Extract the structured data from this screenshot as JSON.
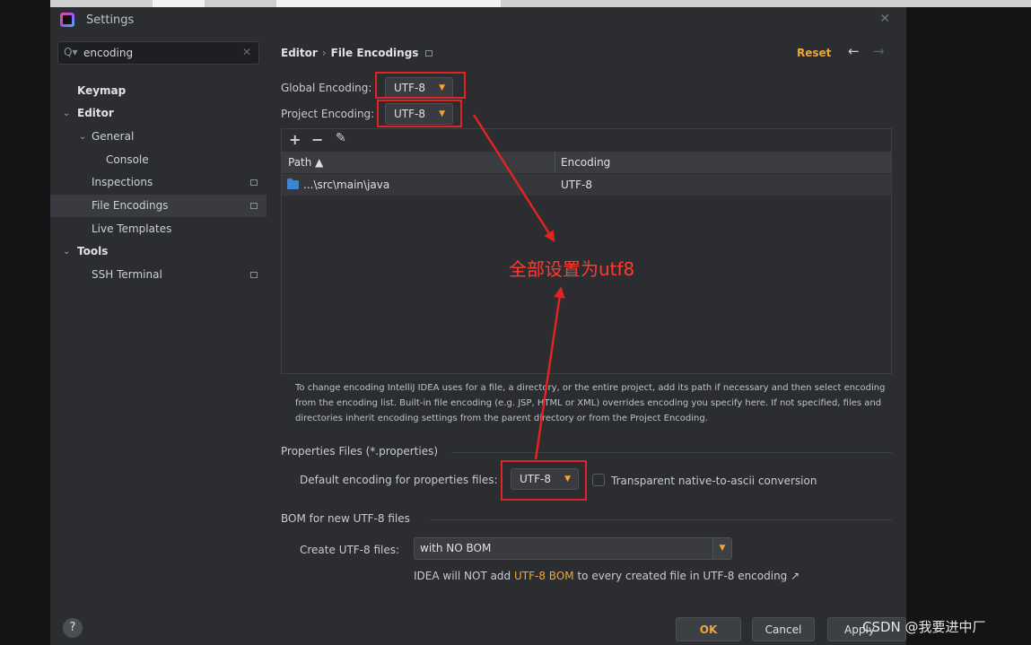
{
  "window": {
    "title": "Settings"
  },
  "search": {
    "value": "encoding"
  },
  "sidebar": {
    "items": [
      {
        "label": "Keymap"
      },
      {
        "label": "Editor"
      },
      {
        "label": "General"
      },
      {
        "label": "Console"
      },
      {
        "label": "Inspections"
      },
      {
        "label": "File Encodings"
      },
      {
        "label": "Live Templates"
      },
      {
        "label": "Tools"
      },
      {
        "label": "SSH Terminal"
      }
    ]
  },
  "header": {
    "breadcrumb_parent": "Editor",
    "breadcrumb_sep": "›",
    "breadcrumb_current": "File Encodings",
    "reset_label": "Reset"
  },
  "global_encoding": {
    "label": "Global Encoding:",
    "value": "UTF-8"
  },
  "project_encoding": {
    "label": "Project Encoding:",
    "value": "UTF-8"
  },
  "table": {
    "toolbar": {
      "add": "+",
      "remove": "−",
      "edit": "✎"
    },
    "columns": {
      "path": "Path ▲",
      "encoding": "Encoding"
    },
    "rows": [
      {
        "path": "...\\src\\main\\java",
        "encoding": "UTF-8"
      }
    ]
  },
  "description": "To change encoding IntelliJ IDEA uses for a file, a directory, or the entire project, add its path if necessary and then select encoding from the encoding list. Built-in file encoding (e.g. JSP, HTML or XML) overrides encoding you specify here. If not specified, files and directories inherit encoding settings from the parent directory or from the Project Encoding.",
  "properties": {
    "section_title": "Properties Files (*.properties)",
    "default_label": "Default encoding for properties files:",
    "default_value": "UTF-8",
    "transparent_label": "Transparent native-to-ascii conversion"
  },
  "bom": {
    "section_title": "BOM for new UTF-8 files",
    "create_label": "Create UTF-8 files:",
    "create_value": "with NO BOM",
    "note_prefix": "IDEA will NOT add",
    "note_highlight": "UTF-8 BOM",
    "note_suffix": "to every created file in UTF-8 encoding ↗"
  },
  "footer": {
    "help": "?",
    "ok": "OK",
    "cancel": "Cancel",
    "apply": "Apply"
  },
  "annotation": {
    "text": "全部设置为utf8"
  },
  "watermark": {
    "text": "CSDN @我要进中厂"
  },
  "colors": {
    "accent": "#f0a732",
    "annotation": "#e02424",
    "background": "#2b2d30"
  }
}
